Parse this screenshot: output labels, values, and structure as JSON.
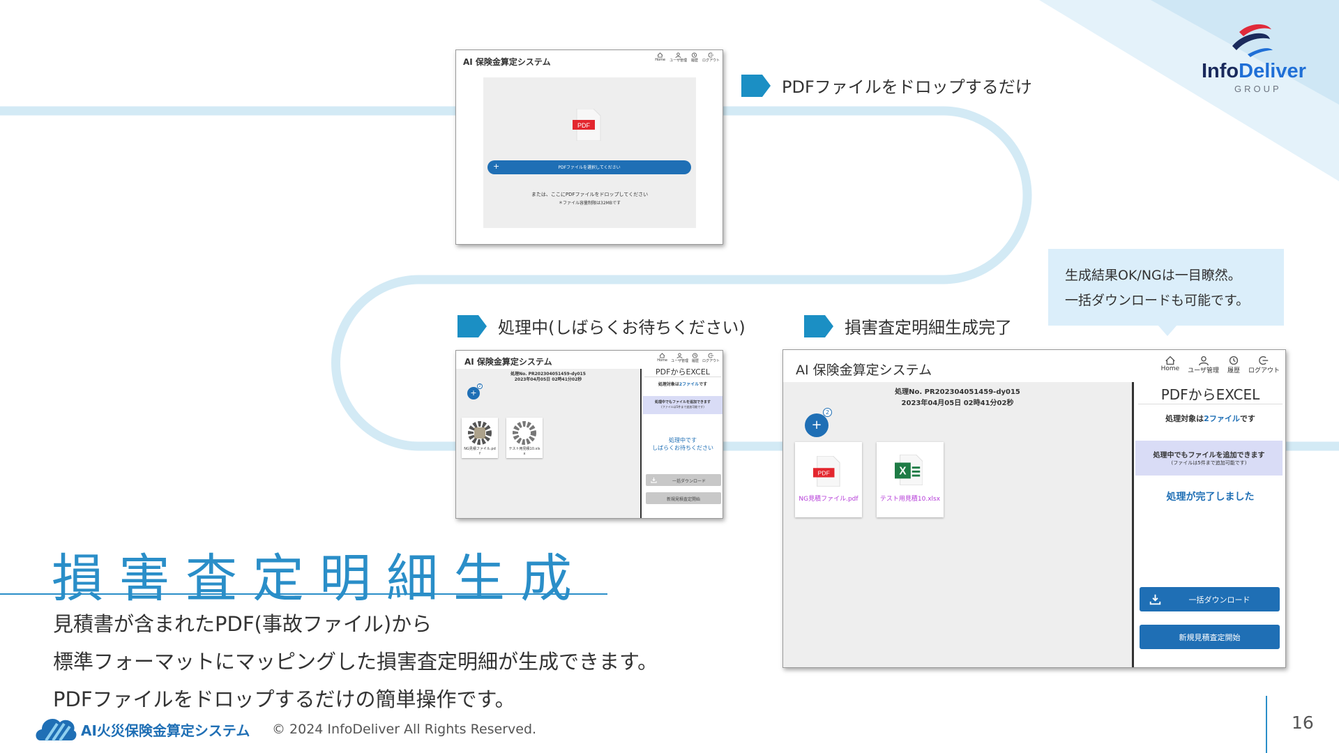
{
  "logo": {
    "text_info": "Info",
    "text_deliver": "Deliver",
    "group": "GROUP"
  },
  "steps": {
    "step1": "PDFファイルをドロップするだけ",
    "step2": "処理中(しばらくお待ちください)",
    "step3": "損害査定明細生成完了"
  },
  "callout": {
    "line1": "生成結果OK/NGは一目瞭然。",
    "line2": "一括ダウンロードも可能です。"
  },
  "app": {
    "title": "AI 保険金算定システム",
    "nav": [
      "Home",
      "ユーザ管理",
      "履歴",
      "ログアウト"
    ],
    "upload": {
      "badge": "PDF",
      "select_button": "PDFファイルを選択してください",
      "drop_text": "または、ここにPDFファイルをドロップしてください",
      "size_note": "＊ファイル容量制限は32MBです"
    },
    "process_no": "処理No. PR202304051459-dy015",
    "process_date": "2023年04月05日 02時41分02秒",
    "add_count": "2",
    "panel_title": "PDFからEXCEL",
    "target_prefix": "処理対象は",
    "target_count": "2ファイル",
    "target_suffix": "です",
    "add_note": "処理中でもファイルを追加できます",
    "add_note_sub": "(ファイルは5件まで追加可能です)",
    "processing_line1": "処理中です",
    "processing_line2": "しばらくお待ちください",
    "done_text": "処理が完了しました",
    "download_button": "一括ダウンロード",
    "new_button": "新規見積査定開始",
    "files_processing": [
      {
        "name": "NG見積ファイル.pdf"
      },
      {
        "name": "テスト用見積10.xlsx"
      }
    ],
    "files_done": [
      {
        "name": "NG見積ファイル.pdf",
        "type": "pdf",
        "badge": "PDF"
      },
      {
        "name": "テスト用見積10.xlsx",
        "type": "xlsx",
        "badge": "X"
      }
    ]
  },
  "main_title": "損害査定明細生成",
  "description": [
    "見積書が含まれたPDF(事故ファイル)から",
    "標準フォーマットにマッピングした損害査定明細が生成できます。",
    "PDFファイルをドロップするだけの簡単操作です。"
  ],
  "footer": {
    "brand": "AI火災保険金算定システム",
    "copyright": "© 2024 InfoDeliver All Rights Reserved.",
    "page": "16"
  },
  "colors": {
    "accent": "#2a8ec8",
    "step_marker": "#1b8fc4",
    "track": "#d3eaf5",
    "button": "#1f6fb5"
  }
}
